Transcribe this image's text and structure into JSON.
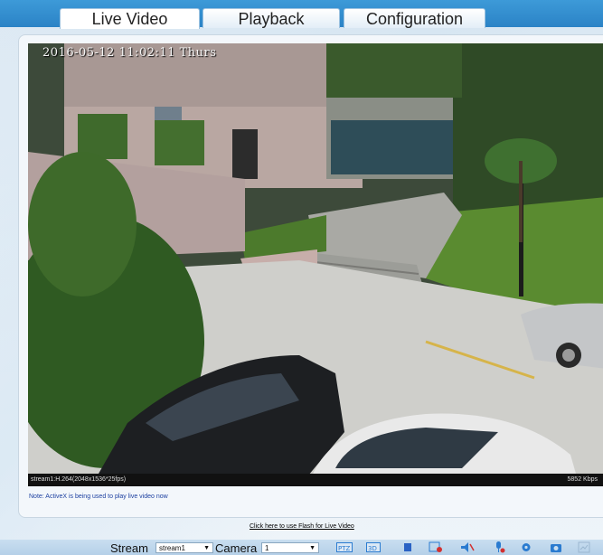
{
  "tabs": [
    {
      "label": "Live Video",
      "active": true
    },
    {
      "label": "Playback",
      "active": false
    },
    {
      "label": "Configuration",
      "active": false
    }
  ],
  "video": {
    "osd_timestamp": "2016-05-12 11:02:11 Thurs",
    "stream_info": "stream1:H.264(2048x1536*25fps)",
    "bitrate": "5852 Kbps"
  },
  "note": "Note: ActiveX is being used to play live video now",
  "flash_link": "Click here to use Flash for Live Video",
  "toolbar": {
    "stream_label": "Stream",
    "stream_value": "stream1",
    "camera_label": "Camera",
    "camera_value": "1",
    "icons": [
      "ptz-icon",
      "3d-zoom-icon",
      "stop-icon",
      "record-icon",
      "audio-icon",
      "mic-icon",
      "settings-icon",
      "snapshot-icon",
      "fullscreen-icon"
    ]
  },
  "colors": {
    "tabbar": "#2b83c6",
    "accent_icon": "#2a7bd0",
    "alert_icon": "#d23030"
  }
}
